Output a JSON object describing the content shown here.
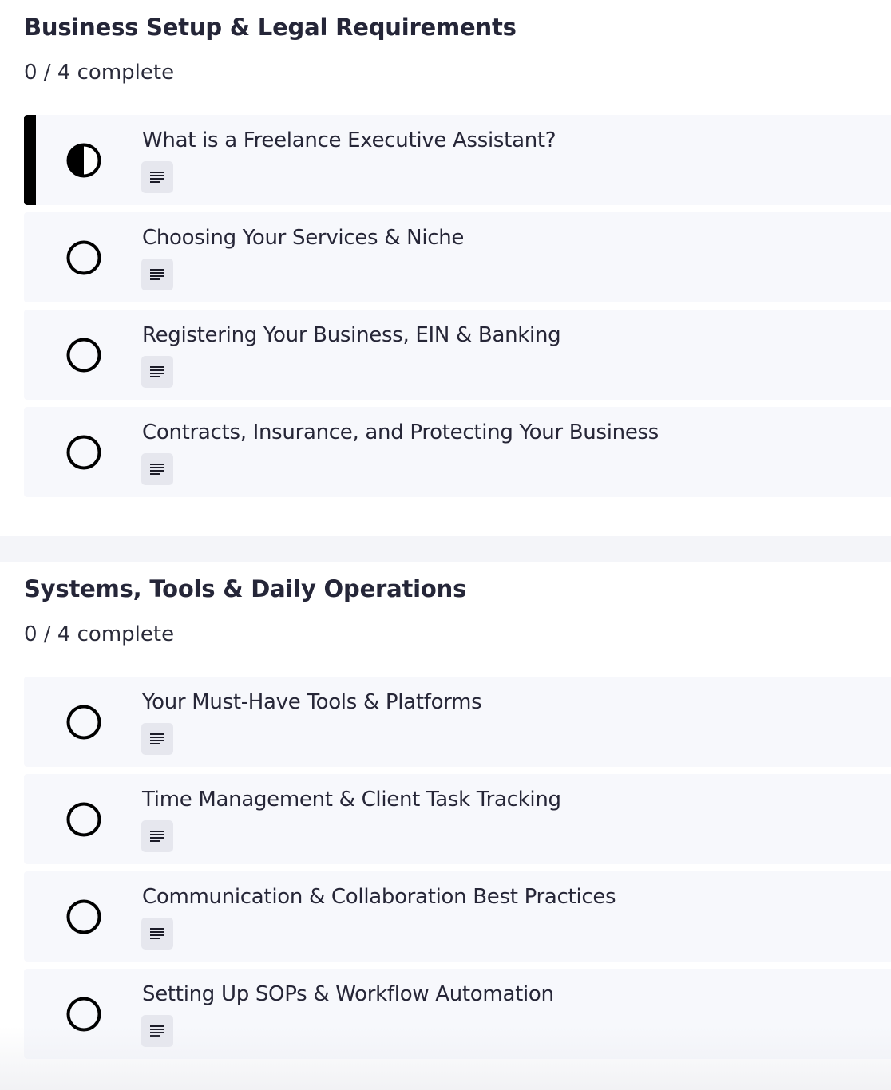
{
  "sections": [
    {
      "title": "Business Setup & Legal Requirements",
      "progress": "0 / 4 complete",
      "lessons": [
        {
          "title": "What is a Freelance Executive Assistant?",
          "status": "in-progress",
          "icon": "half-circle-icon",
          "type_icon": "text-lines-icon"
        },
        {
          "title": "Choosing Your Services & Niche",
          "status": "not-started",
          "icon": "empty-circle-icon",
          "type_icon": "text-lines-icon"
        },
        {
          "title": "Registering Your Business, EIN & Banking",
          "status": "not-started",
          "icon": "empty-circle-icon",
          "type_icon": "text-lines-icon"
        },
        {
          "title": "Contracts, Insurance, and Protecting Your Business",
          "status": "not-started",
          "icon": "empty-circle-icon",
          "type_icon": "text-lines-icon"
        }
      ]
    },
    {
      "title": "Systems, Tools & Daily Operations",
      "progress": "0 / 4 complete",
      "lessons": [
        {
          "title": "Your Must-Have Tools & Platforms",
          "status": "not-started",
          "icon": "empty-circle-icon",
          "type_icon": "text-lines-icon"
        },
        {
          "title": "Time Management & Client Task Tracking",
          "status": "not-started",
          "icon": "empty-circle-icon",
          "type_icon": "text-lines-icon"
        },
        {
          "title": "Communication & Collaboration Best Practices",
          "status": "not-started",
          "icon": "empty-circle-icon",
          "type_icon": "text-lines-icon"
        },
        {
          "title": "Setting Up SOPs & Workflow Automation",
          "status": "not-started",
          "icon": "empty-circle-icon",
          "type_icon": "text-lines-icon"
        }
      ]
    }
  ],
  "colors": {
    "card_background": "#f7f8fc",
    "active_indicator": "#000000",
    "badge_background": "#e6e7ee",
    "divider": "#f4f5f9"
  }
}
